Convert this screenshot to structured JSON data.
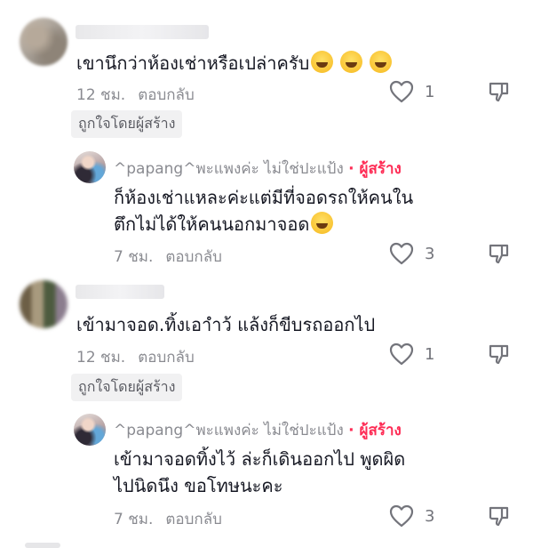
{
  "comments": [
    {
      "text": "เขานึกว่าห้องเช่าหรือเปล่าครับ",
      "time": "12 ชม.",
      "reply": "ตอบกลับ",
      "likes": "1",
      "liked_by_creator": "ถูกใจโดยผู้สร้าง"
    },
    {
      "username": "^papang^พะแพงค่ะ ไม่ใช่ปะแป้ง",
      "creator_tag": "· ผู้สร้าง",
      "text_line1": "ก็ห้องเช่าแหละค่ะแต่มีที่จอดรถให้คนใน",
      "text_line2": "ตึกไม่ได้ให้คนนอกมาจอด",
      "time": "7 ชม.",
      "reply": "ตอบกลับ",
      "likes": "3"
    },
    {
      "text": "เข้ามาจอด.ทิ้งเอาำว้ แล้งก็ขีบรถออกไป",
      "time": "12 ชม.",
      "reply": "ตอบกลับ",
      "likes": "1",
      "liked_by_creator": "ถูกใจโดยผู้สร้าง"
    },
    {
      "username": "^papang^พะแพงค่ะ ไม่ใช่ปะแป้ง",
      "creator_tag": "· ผู้สร้าง",
      "text_line1": "เข้ามาจอดทิ้งไว้ ล่ะก็เดินออกไป พูดผิด",
      "text_line2": "ไปนิดนึง ขอโทษนะคะ",
      "time": "7 ชม.",
      "reply": "ตอบกลับ",
      "likes": "3"
    }
  ],
  "icons": {
    "like": "heart-outline-icon",
    "dislike": "thumbs-down-outline-icon",
    "emoji": "grinning-sweat-emoji"
  },
  "colors": {
    "creator_accent": "#fe2c55",
    "meta_gray": "#8a8b91",
    "text": "#161823"
  }
}
